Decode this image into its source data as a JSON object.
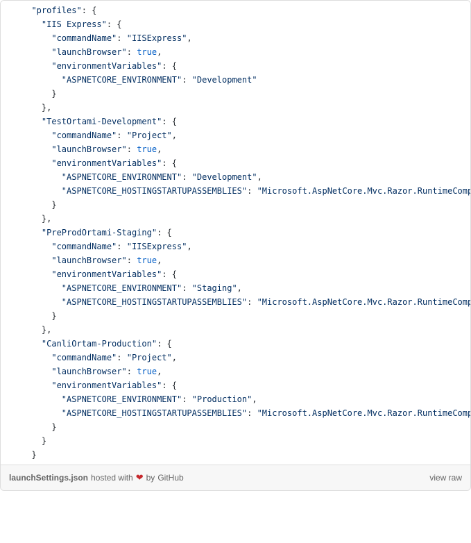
{
  "filename": "launchSettings.json",
  "hosted_with": "hosted with",
  "by": "by",
  "github": "GitHub",
  "view_raw": "view raw",
  "heart": "❤",
  "code_lines": [
    {
      "indent": 1,
      "tokens": [
        {
          "t": "k",
          "v": "\"profiles\""
        },
        {
          "t": "p",
          "v": ": {"
        }
      ]
    },
    {
      "indent": 2,
      "tokens": [
        {
          "t": "k",
          "v": "\"IIS Express\""
        },
        {
          "t": "p",
          "v": ": {"
        }
      ]
    },
    {
      "indent": 3,
      "tokens": [
        {
          "t": "k",
          "v": "\"commandName\""
        },
        {
          "t": "p",
          "v": ": "
        },
        {
          "t": "s",
          "v": "\"IISExpress\""
        },
        {
          "t": "p",
          "v": ","
        }
      ]
    },
    {
      "indent": 3,
      "tokens": [
        {
          "t": "k",
          "v": "\"launchBrowser\""
        },
        {
          "t": "p",
          "v": ": "
        },
        {
          "t": "b",
          "v": "true"
        },
        {
          "t": "p",
          "v": ","
        }
      ]
    },
    {
      "indent": 3,
      "tokens": [
        {
          "t": "k",
          "v": "\"environmentVariables\""
        },
        {
          "t": "p",
          "v": ": {"
        }
      ]
    },
    {
      "indent": 4,
      "tokens": [
        {
          "t": "k",
          "v": "\"ASPNETCORE_ENVIRONMENT\""
        },
        {
          "t": "p",
          "v": ": "
        },
        {
          "t": "s",
          "v": "\"Development\""
        }
      ]
    },
    {
      "indent": 3,
      "tokens": [
        {
          "t": "p",
          "v": "}"
        }
      ]
    },
    {
      "indent": 2,
      "tokens": [
        {
          "t": "p",
          "v": "},"
        }
      ]
    },
    {
      "indent": 2,
      "tokens": [
        {
          "t": "k",
          "v": "\"TestOrtami-Development\""
        },
        {
          "t": "p",
          "v": ": {"
        }
      ]
    },
    {
      "indent": 3,
      "tokens": [
        {
          "t": "k",
          "v": "\"commandName\""
        },
        {
          "t": "p",
          "v": ": "
        },
        {
          "t": "s",
          "v": "\"Project\""
        },
        {
          "t": "p",
          "v": ","
        }
      ]
    },
    {
      "indent": 3,
      "tokens": [
        {
          "t": "k",
          "v": "\"launchBrowser\""
        },
        {
          "t": "p",
          "v": ": "
        },
        {
          "t": "b",
          "v": "true"
        },
        {
          "t": "p",
          "v": ","
        }
      ]
    },
    {
      "indent": 3,
      "tokens": [
        {
          "t": "k",
          "v": "\"environmentVariables\""
        },
        {
          "t": "p",
          "v": ": {"
        }
      ]
    },
    {
      "indent": 4,
      "tokens": [
        {
          "t": "k",
          "v": "\"ASPNETCORE_ENVIRONMENT\""
        },
        {
          "t": "p",
          "v": ": "
        },
        {
          "t": "s",
          "v": "\"Development\""
        },
        {
          "t": "p",
          "v": ","
        }
      ]
    },
    {
      "indent": 4,
      "tokens": [
        {
          "t": "k",
          "v": "\"ASPNETCORE_HOSTINGSTARTUPASSEMBLIES\""
        },
        {
          "t": "p",
          "v": ": "
        },
        {
          "t": "s",
          "v": "\"Microsoft.AspNetCore.Mvc.Razor.RuntimeCompilation\""
        }
      ]
    },
    {
      "indent": 3,
      "tokens": [
        {
          "t": "p",
          "v": "}"
        }
      ]
    },
    {
      "indent": 2,
      "tokens": [
        {
          "t": "p",
          "v": "},"
        }
      ]
    },
    {
      "indent": 2,
      "tokens": [
        {
          "t": "k",
          "v": "\"PreProdOrtami-Staging\""
        },
        {
          "t": "p",
          "v": ": {"
        }
      ]
    },
    {
      "indent": 3,
      "tokens": [
        {
          "t": "k",
          "v": "\"commandName\""
        },
        {
          "t": "p",
          "v": ": "
        },
        {
          "t": "s",
          "v": "\"IISExpress\""
        },
        {
          "t": "p",
          "v": ","
        }
      ]
    },
    {
      "indent": 3,
      "tokens": [
        {
          "t": "k",
          "v": "\"launchBrowser\""
        },
        {
          "t": "p",
          "v": ": "
        },
        {
          "t": "b",
          "v": "true"
        },
        {
          "t": "p",
          "v": ","
        }
      ]
    },
    {
      "indent": 3,
      "tokens": [
        {
          "t": "k",
          "v": "\"environmentVariables\""
        },
        {
          "t": "p",
          "v": ": {"
        }
      ]
    },
    {
      "indent": 4,
      "tokens": [
        {
          "t": "k",
          "v": "\"ASPNETCORE_ENVIRONMENT\""
        },
        {
          "t": "p",
          "v": ": "
        },
        {
          "t": "s",
          "v": "\"Staging\""
        },
        {
          "t": "p",
          "v": ","
        }
      ]
    },
    {
      "indent": 4,
      "tokens": [
        {
          "t": "k",
          "v": "\"ASPNETCORE_HOSTINGSTARTUPASSEMBLIES\""
        },
        {
          "t": "p",
          "v": ": "
        },
        {
          "t": "s",
          "v": "\"Microsoft.AspNetCore.Mvc.Razor.RuntimeCompilation\""
        }
      ]
    },
    {
      "indent": 3,
      "tokens": [
        {
          "t": "p",
          "v": "}"
        }
      ]
    },
    {
      "indent": 2,
      "tokens": [
        {
          "t": "p",
          "v": "},"
        }
      ]
    },
    {
      "indent": 2,
      "tokens": [
        {
          "t": "k",
          "v": "\"CanliOrtam-Production\""
        },
        {
          "t": "p",
          "v": ": {"
        }
      ]
    },
    {
      "indent": 3,
      "tokens": [
        {
          "t": "k",
          "v": "\"commandName\""
        },
        {
          "t": "p",
          "v": ": "
        },
        {
          "t": "s",
          "v": "\"Project\""
        },
        {
          "t": "p",
          "v": ","
        }
      ]
    },
    {
      "indent": 3,
      "tokens": [
        {
          "t": "k",
          "v": "\"launchBrowser\""
        },
        {
          "t": "p",
          "v": ": "
        },
        {
          "t": "b",
          "v": "true"
        },
        {
          "t": "p",
          "v": ","
        }
      ]
    },
    {
      "indent": 3,
      "tokens": [
        {
          "t": "k",
          "v": "\"environmentVariables\""
        },
        {
          "t": "p",
          "v": ": {"
        }
      ]
    },
    {
      "indent": 4,
      "tokens": [
        {
          "t": "k",
          "v": "\"ASPNETCORE_ENVIRONMENT\""
        },
        {
          "t": "p",
          "v": ": "
        },
        {
          "t": "s",
          "v": "\"Production\""
        },
        {
          "t": "p",
          "v": ","
        }
      ]
    },
    {
      "indent": 4,
      "tokens": [
        {
          "t": "k",
          "v": "\"ASPNETCORE_HOSTINGSTARTUPASSEMBLIES\""
        },
        {
          "t": "p",
          "v": ": "
        },
        {
          "t": "s",
          "v": "\"Microsoft.AspNetCore.Mvc.Razor.RuntimeCompilation\""
        }
      ]
    },
    {
      "indent": 3,
      "tokens": [
        {
          "t": "p",
          "v": "}"
        }
      ]
    },
    {
      "indent": 2,
      "tokens": [
        {
          "t": "p",
          "v": "}"
        }
      ]
    },
    {
      "indent": 1,
      "tokens": [
        {
          "t": "p",
          "v": "}"
        }
      ]
    }
  ]
}
